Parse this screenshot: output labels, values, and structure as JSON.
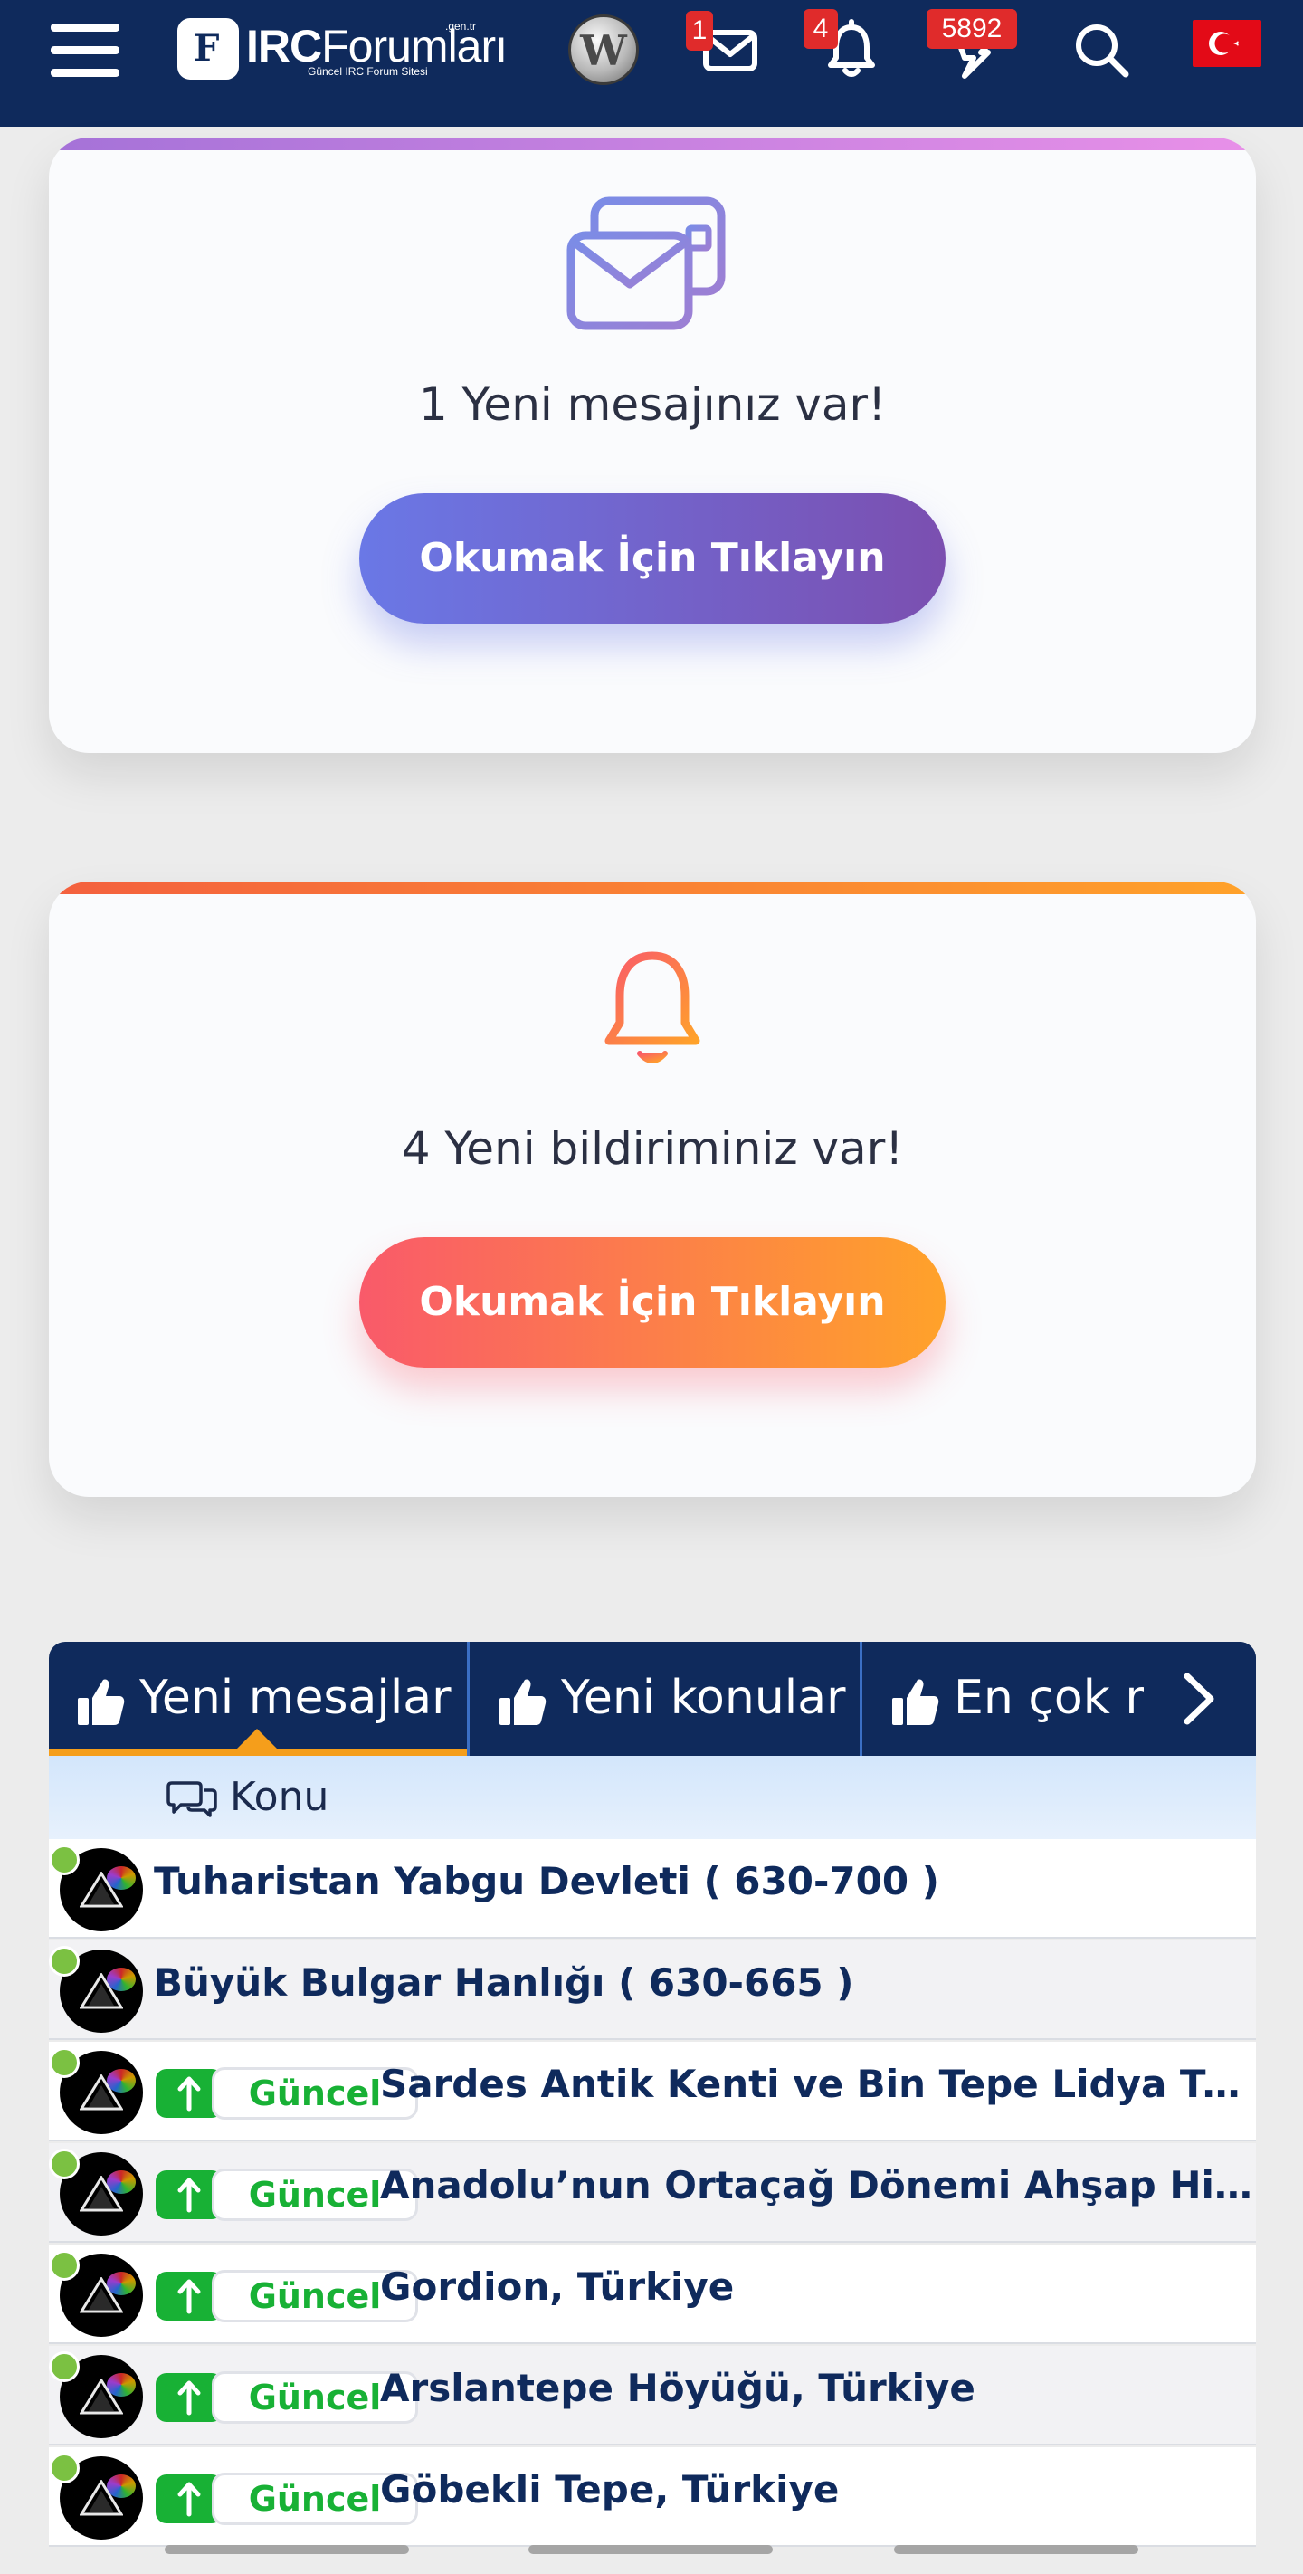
{
  "header": {
    "logo_brand_bold": "IRC",
    "logo_brand_rest": "Forumları",
    "logo_domain": ".gen.tr",
    "logo_slogan": "Güncel IRC Forum Sitesi",
    "user_avatar_letter": "W",
    "messages_count": "1",
    "notifications_count": "4",
    "activity_count": "5892"
  },
  "messages_card": {
    "text": "1 Yeni mesajınız var!",
    "button_label": "Okumak İçin Tıklayın"
  },
  "notifications_card": {
    "text": "4 Yeni bildiriminiz var!",
    "button_label": "Okumak İçin Tıklayın"
  },
  "tabs": [
    {
      "label": "Yeni mesajlar"
    },
    {
      "label": "Yeni konular"
    },
    {
      "label": "En çok mesaj"
    }
  ],
  "list": {
    "header_label": "Konu",
    "prefix_label": "Güncel",
    "rows": [
      {
        "title": "Tuharistan Yabgu Devleti ( 630-700 )"
      },
      {
        "title": "Büyük Bulgar Hanlığı ( 630-665 )"
      },
      {
        "title": "Sardes Antik Kenti ve Bin Tepe Lidya Tümülüsleri"
      },
      {
        "title": "Anadolu’nun Ortaçağ Dönemi Ahşap Hipostil Camileri"
      },
      {
        "title": "Gordion, Türkiye"
      },
      {
        "title": "Arslantepe Höyüğü, Türkiye"
      },
      {
        "title": "Göbekli Tepe, Türkiye"
      }
    ]
  },
  "colors": {
    "header_bg": "#0f2a5c",
    "message_accent_start": "#6a78e6",
    "message_accent_end": "#7b4fb0",
    "notification_accent_start": "#f95a6a",
    "notification_accent_end": "#ffa22a",
    "tab_active_indicator": "#f59e1b",
    "guncel_green": "#18b135",
    "badge_red": "#e02b2b"
  }
}
